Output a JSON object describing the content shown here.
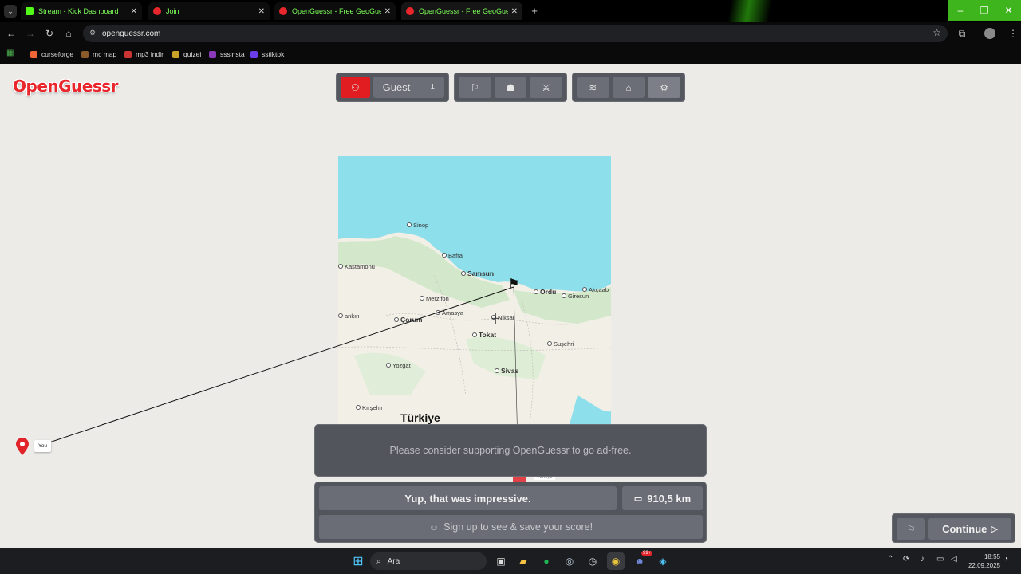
{
  "browser": {
    "tabs": [
      {
        "title": "Stream - Kick Dashboard",
        "favicon_color": "#53fc18"
      },
      {
        "title": "Join",
        "favicon_color": "#e8262c"
      },
      {
        "title": "OpenGuessr - Free GeoGuessr Alternative",
        "favicon_color": "#e8262c"
      },
      {
        "title": "OpenGuessr - Free GeoGuessr Alternative",
        "favicon_color": "#e8262c"
      }
    ],
    "url": "openguessr.com",
    "bookmarks": [
      {
        "label": "curseforge",
        "color": "#f16436"
      },
      {
        "label": "mc map",
        "color": "#8b5a2b"
      },
      {
        "label": "mp3 indir",
        "color": "#c33"
      },
      {
        "label": "quizei",
        "color": "#c9a227"
      },
      {
        "label": "sssinsta",
        "color": "#8a3ab9"
      },
      {
        "label": "sstiktok",
        "color": "#6a3de8"
      }
    ]
  },
  "app": {
    "logo": "OpenGuessr",
    "user": {
      "name": "Guest",
      "count": "1"
    },
    "accent": "#e21d22"
  },
  "map": {
    "cities": [
      "Sinop",
      "Bafra",
      "Kastamonu",
      "Samsun",
      "Akçaab",
      "Ordu",
      "Giresun",
      "Merzifon",
      "Amasya",
      "Niksar",
      "Çorum",
      "ankırı",
      "Tokat",
      "Suşehri",
      "Yozgat",
      "Sivas",
      "Kırşehir"
    ],
    "country": "Türkiye",
    "marker_label": "You",
    "hidden_label": "Türkiye"
  },
  "result": {
    "ad_text": "Please consider supporting OpenGuessr to go ad-free.",
    "message": "Yup, that was impressive.",
    "distance": "910,5 km",
    "signup": "Sign up to see & save your score!",
    "continue": "Continue"
  },
  "taskbar": {
    "search": "Ara",
    "time": "18:55",
    "date": "22.09.2025",
    "discord_badge": "99+"
  }
}
